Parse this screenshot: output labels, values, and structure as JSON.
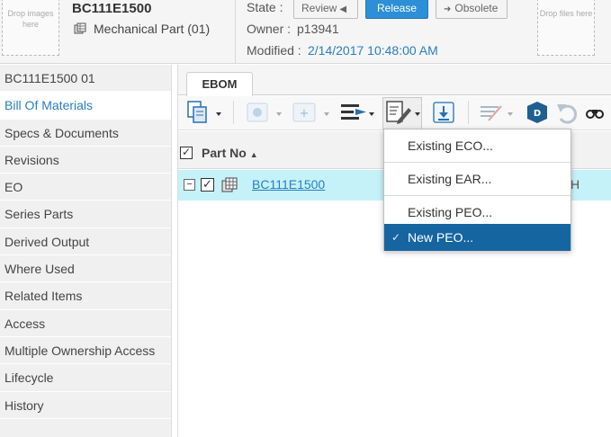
{
  "header": {
    "drop_images": "Drop images here",
    "drop_files": "Drop files here",
    "part_number": "BC111E1500",
    "part_type": "Mechanical Part (01)",
    "state_label": "State :",
    "owner_label": "Owner :",
    "owner_value": "p13941",
    "modified_label": "Modified :",
    "modified_value": "2/14/2017 10:48:00 AM",
    "buttons": {
      "review": "Review",
      "release": "Release",
      "obsolete": "Obsolete"
    }
  },
  "sidebar": {
    "items": [
      {
        "label": "BC111E1500 01",
        "active": false
      },
      {
        "label": "Bill Of Materials",
        "active": true
      },
      {
        "label": "Specs & Documents",
        "active": false
      },
      {
        "label": "Revisions",
        "active": false
      },
      {
        "label": "EO",
        "active": false
      },
      {
        "label": "Series Parts",
        "active": false
      },
      {
        "label": "Derived Output",
        "active": false
      },
      {
        "label": "Where Used",
        "active": false
      },
      {
        "label": "Related Items",
        "active": false
      },
      {
        "label": "Access",
        "active": false
      },
      {
        "label": "Multiple Ownership Access",
        "active": false
      },
      {
        "label": "Lifecycle",
        "active": false
      },
      {
        "label": "History",
        "active": false
      }
    ]
  },
  "main": {
    "tab": "EBOM",
    "grid": {
      "column_header": "Part No",
      "row": {
        "part_no": "BC111E1500",
        "trailing_text": "H"
      }
    },
    "toolbar_icons": [
      "copy-icon",
      "add-new-icon",
      "add-existing-icon",
      "indent-icon",
      "edit-change-icon",
      "export-icon",
      "filter-icon",
      "3d-view-icon",
      "undo-icon",
      "find-icon"
    ]
  },
  "menu": {
    "items": [
      {
        "label": "Existing ECO...",
        "selected": false
      },
      {
        "label": "Existing EAR...",
        "selected": false
      },
      {
        "label": "Existing PEO...",
        "selected": false
      },
      {
        "label": "New PEO...",
        "selected": true
      }
    ]
  },
  "colors": {
    "accent": "#2a7ec1",
    "release_button": "#2d8fd5",
    "row_highlight": "#c5f2f8",
    "menu_selected": "#1565a1"
  }
}
